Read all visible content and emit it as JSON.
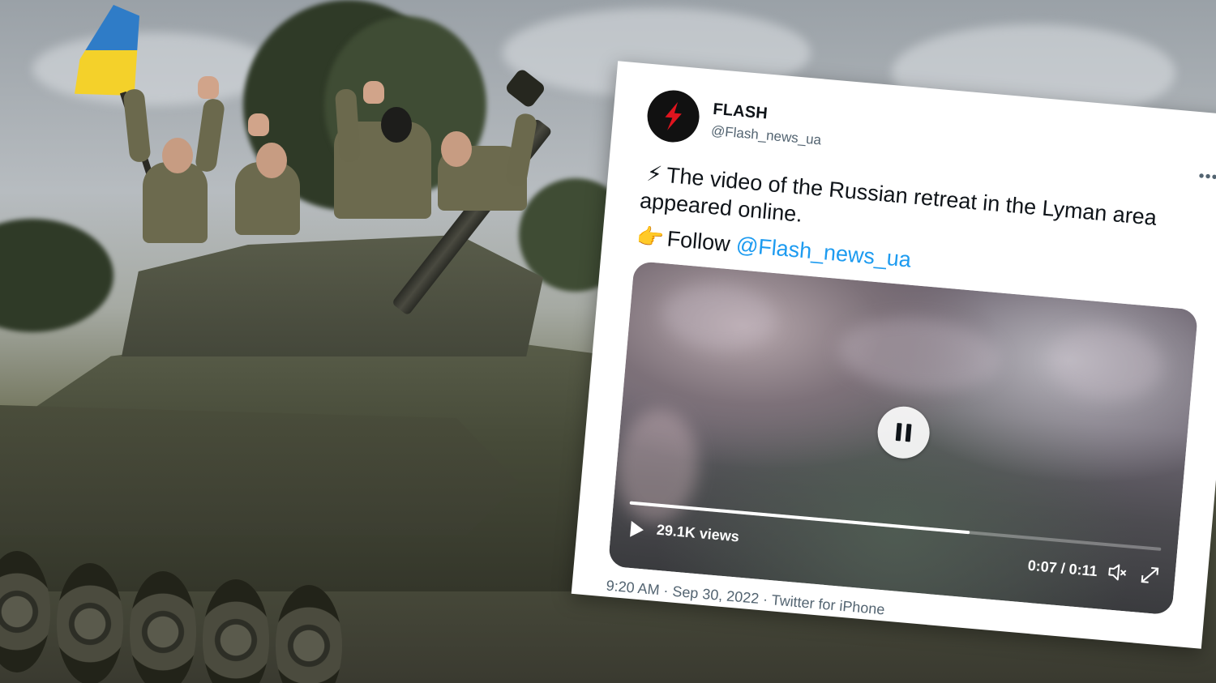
{
  "tweet": {
    "display_name": "FLASH",
    "handle": "@Flash_news_ua",
    "more_icon": "ellipsis-icon",
    "avatar_icon": "lightning-bolt-logo",
    "text_emoji_1": "⚡",
    "text_line_1": "The video of the Russian retreat in the Lyman area",
    "text_line_2": "appeared online.",
    "text_emoji_2": "👉",
    "follow_word": "Follow",
    "mention": "@Flash_news_ua",
    "meta": "9:20 AM · Sep 30, 2022 · Twitter for iPhone"
  },
  "video": {
    "views": "29.1K views",
    "time": "0:07 / 0:11",
    "progress": 0.64,
    "state": "playing",
    "pause_icon": "pause-icon",
    "play_icon": "play-icon",
    "mute_icon": "muted-speaker-icon",
    "fullscreen_icon": "fullscreen-icon"
  },
  "colors": {
    "link": "#1d9bf0",
    "secondary_text": "#536471",
    "avatar_bg": "#111111",
    "avatar_bolt": "#e0141e",
    "flag_blue": "#2f7cc7",
    "flag_yellow": "#f4d12a"
  }
}
